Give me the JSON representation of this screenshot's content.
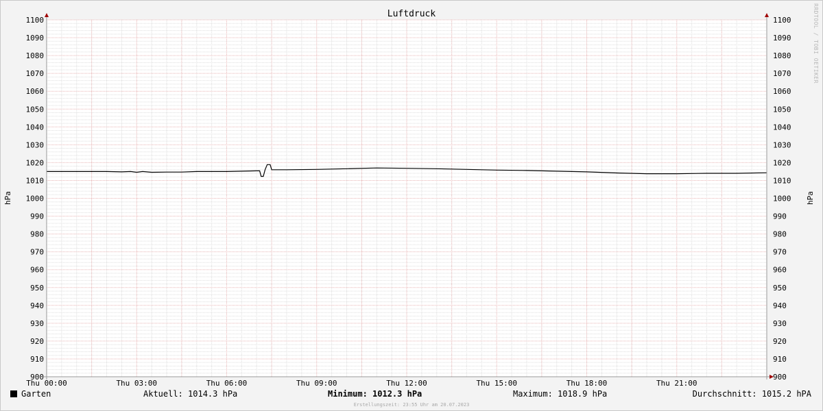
{
  "chart_data": {
    "type": "line",
    "title": "Luftdruck",
    "ylabel": "hPa",
    "ylim": [
      900,
      1100
    ],
    "y_major_ticks": [
      900,
      910,
      920,
      930,
      940,
      950,
      960,
      970,
      980,
      990,
      1000,
      1010,
      1020,
      1030,
      1040,
      1050,
      1060,
      1070,
      1080,
      1090,
      1100
    ],
    "x_range_hours": [
      0,
      24
    ],
    "x_tick_labels": [
      {
        "hour": 0,
        "label": "Thu 00:00"
      },
      {
        "hour": 3,
        "label": "Thu 03:00"
      },
      {
        "hour": 6,
        "label": "Thu 06:00"
      },
      {
        "hour": 9,
        "label": "Thu 09:00"
      },
      {
        "hour": 12,
        "label": "Thu 12:00"
      },
      {
        "hour": 15,
        "label": "Thu 15:00"
      },
      {
        "hour": 18,
        "label": "Thu 18:00"
      },
      {
        "hour": 21,
        "label": "Thu 21:00"
      }
    ],
    "grid": true,
    "series": [
      {
        "name": "Garten",
        "color": "#000000",
        "points": [
          [
            0.0,
            1015.0
          ],
          [
            1.0,
            1015.0
          ],
          [
            2.0,
            1015.0
          ],
          [
            2.5,
            1014.8
          ],
          [
            2.8,
            1015.0
          ],
          [
            3.0,
            1014.6
          ],
          [
            3.2,
            1015.0
          ],
          [
            3.5,
            1014.6
          ],
          [
            4.0,
            1014.7
          ],
          [
            4.5,
            1014.7
          ],
          [
            5.0,
            1015.0
          ],
          [
            6.0,
            1015.0
          ],
          [
            6.5,
            1015.2
          ],
          [
            7.0,
            1015.4
          ],
          [
            7.1,
            1015.4
          ],
          [
            7.15,
            1012.3
          ],
          [
            7.22,
            1012.3
          ],
          [
            7.28,
            1016.0
          ],
          [
            7.35,
            1018.9
          ],
          [
            7.45,
            1018.9
          ],
          [
            7.5,
            1016.0
          ],
          [
            8.0,
            1016.0
          ],
          [
            9.0,
            1016.2
          ],
          [
            10.0,
            1016.6
          ],
          [
            11.0,
            1017.0
          ],
          [
            12.0,
            1016.8
          ],
          [
            13.0,
            1016.6
          ],
          [
            14.0,
            1016.2
          ],
          [
            15.0,
            1015.8
          ],
          [
            16.0,
            1015.6
          ],
          [
            17.0,
            1015.2
          ],
          [
            18.0,
            1014.8
          ],
          [
            19.0,
            1014.2
          ],
          [
            20.0,
            1013.8
          ],
          [
            21.0,
            1013.8
          ],
          [
            22.0,
            1014.0
          ],
          [
            23.0,
            1014.0
          ],
          [
            24.0,
            1014.3
          ]
        ]
      }
    ],
    "legend": {
      "series_label": "Garten",
      "current": "Aktuell: 1014.3 hPa",
      "minimum": "Minimum: 1012.3 hPa",
      "maximum": "Maximum: 1018.9 hPa",
      "average": "Durchschnitt: 1015.2 hPA"
    },
    "watermark": "RRDTOOL / TOBI OETIKER",
    "footer": "Erstellungszeit: 23:55 Uhr am 20.07.2023"
  }
}
